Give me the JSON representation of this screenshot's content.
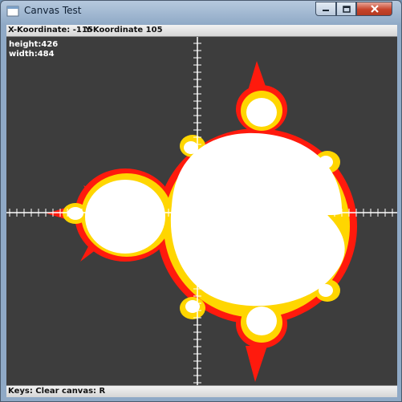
{
  "window": {
    "title": "Canvas Test",
    "icon": "java-app-icon"
  },
  "controls": {
    "minimize": "minimize-icon",
    "maximize": "maximize-icon",
    "close": "close-icon"
  },
  "status": {
    "x_label": "X-Koordinate: -115",
    "y_label": "Y-Koordinate 105"
  },
  "info": {
    "height": "height:426",
    "width": "width:484"
  },
  "keys": {
    "hint": "Keys: Clear canvas: R"
  },
  "colors": {
    "canvas_bg": "#3d3d3d",
    "set": "#ffffff",
    "band_inner": "#ffd600",
    "band_outer": "#ff1a0d",
    "axis": "#ffffff"
  }
}
